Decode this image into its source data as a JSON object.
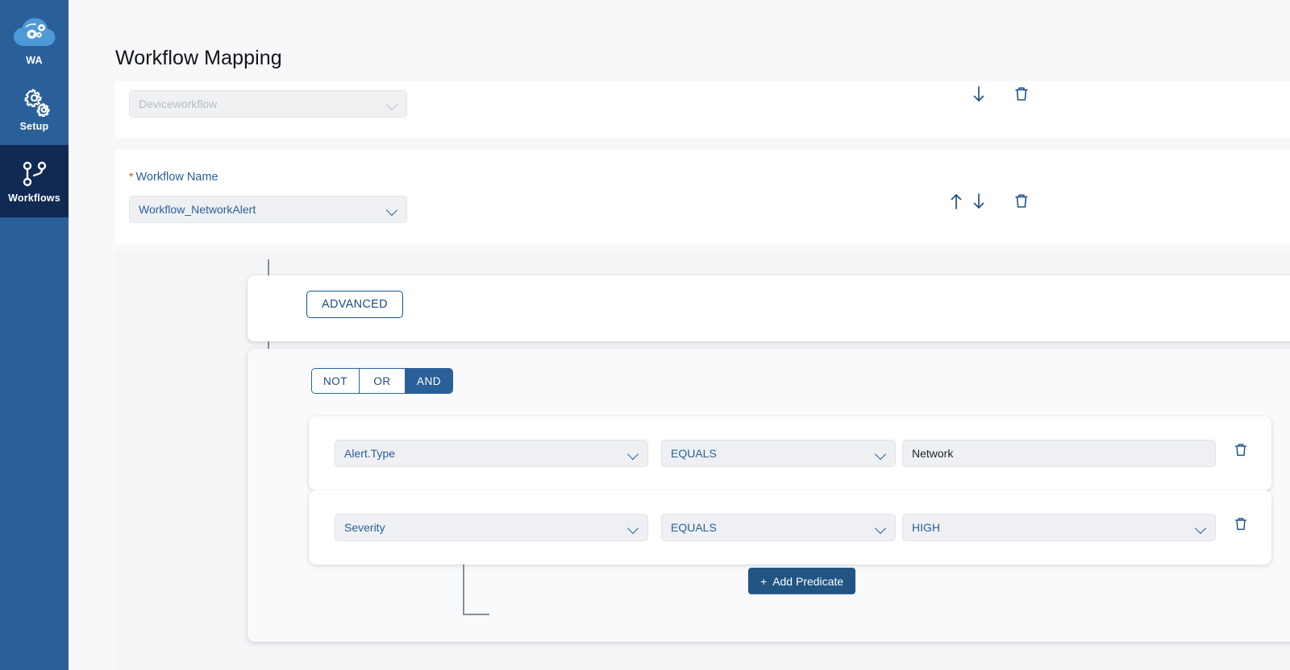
{
  "sidebar": {
    "items": [
      {
        "label": "WA",
        "icon": "cloud-gears-icon",
        "active": false
      },
      {
        "label": "Setup",
        "icon": "gears-icon",
        "active": false
      },
      {
        "label": "Workflows",
        "icon": "workflow-fork-icon",
        "active": true
      }
    ]
  },
  "page": {
    "title": "Workflow Mapping"
  },
  "device_row": {
    "select_value": "Deviceworkflow",
    "move_down_label": "Move down",
    "delete_label": "Delete"
  },
  "workflow_row": {
    "label": "Workflow Name",
    "required_mark": "*",
    "select_value": "Workflow_NetworkAlert",
    "move_up_label": "Move up",
    "move_down_label": "Move down",
    "delete_label": "Delete"
  },
  "advanced": {
    "button_label": "ADVANCED"
  },
  "group": {
    "operators": [
      {
        "label": "NOT",
        "active": false
      },
      {
        "label": "OR",
        "active": false
      },
      {
        "label": "AND",
        "active": true
      }
    ],
    "add_group_label": "+",
    "add_predicate_label": "Add Predicate",
    "add_predicate_plus": "+"
  },
  "predicates": [
    {
      "field": "Alert.Type",
      "field_type": "select",
      "operator": "EQUALS",
      "operator_type": "select",
      "value": "Network",
      "value_type": "text",
      "delete_label": "Delete predicate"
    },
    {
      "field": "Severity",
      "field_type": "select",
      "operator": "EQUALS",
      "operator_type": "select",
      "value": "HIGH",
      "value_type": "select",
      "delete_label": "Delete predicate"
    }
  ],
  "colors": {
    "sidebar_bg": "#2a6099",
    "sidebar_active_bg": "#102a54",
    "accent_blue": "#2a6099",
    "page_bg": "#f7f8fa",
    "panel_bg": "#f4f5f7",
    "control_bg": "#eef0f3",
    "primary_button_bg": "#215582",
    "add_group_bg": "#123148",
    "required_red": "#d9472b"
  }
}
